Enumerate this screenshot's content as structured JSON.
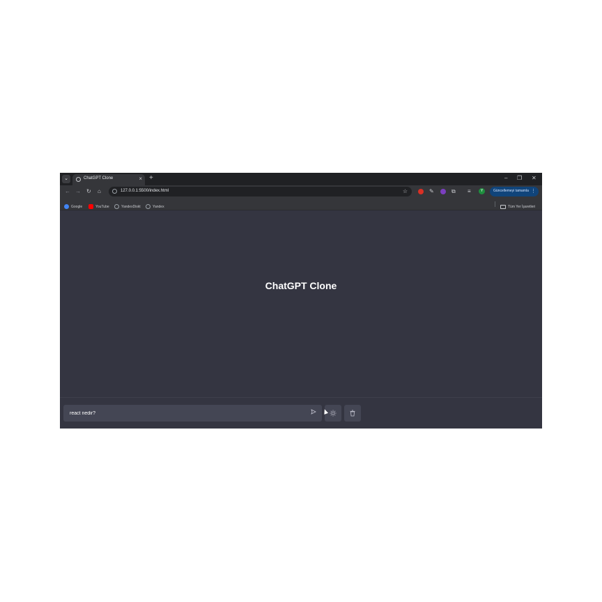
{
  "browser": {
    "tab": {
      "title": "ChatGPT Clone",
      "close": "×"
    },
    "new_tab": "+",
    "window_controls": {
      "minimize": "–",
      "restore": "❐",
      "close": "✕"
    },
    "address": {
      "url": "127.0.0.1:5500/index.html"
    },
    "profile_initial": "Y",
    "update_button": {
      "label": "Güncellemeyi tamamla",
      "menu": "⋮"
    },
    "bookmarks": [
      {
        "label": "Google",
        "icon": "google-icon",
        "color": "#4285f4"
      },
      {
        "label": "YouTube",
        "icon": "youtube-icon",
        "color": "#ff0000"
      },
      {
        "label": "YandexDiskt",
        "icon": "globe-icon",
        "color": "#9aa0a6"
      },
      {
        "label": "Yandex",
        "icon": "globe-icon",
        "color": "#9aa0a6"
      }
    ],
    "all_bookmarks": "Tüm Yer İşaretleri"
  },
  "page": {
    "title": "ChatGPT Clone",
    "input": {
      "value": "react nedir?"
    }
  },
  "colors": {
    "page_bg": "#343541",
    "input_bg": "#444654",
    "chrome_dark": "#202124",
    "chrome_toolbar": "#35363a"
  }
}
